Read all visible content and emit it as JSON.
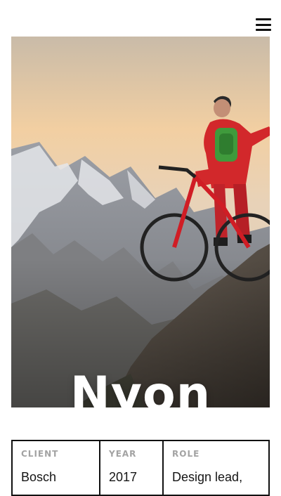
{
  "header": {
    "menu_icon": "hamburger-menu-icon"
  },
  "hero": {
    "title": "Nyon",
    "image_description_icon": "mountain-biker-photo"
  },
  "meta": {
    "client_label": "CLIENT",
    "client_value": "Bosch",
    "year_label": "YEAR",
    "year_value": "2017",
    "role_label": "ROLE",
    "role_value": "Design lead,"
  },
  "colors": {
    "border": "#111111",
    "label": "#a3a3a3",
    "text": "#151515",
    "title": "#ffffff"
  }
}
